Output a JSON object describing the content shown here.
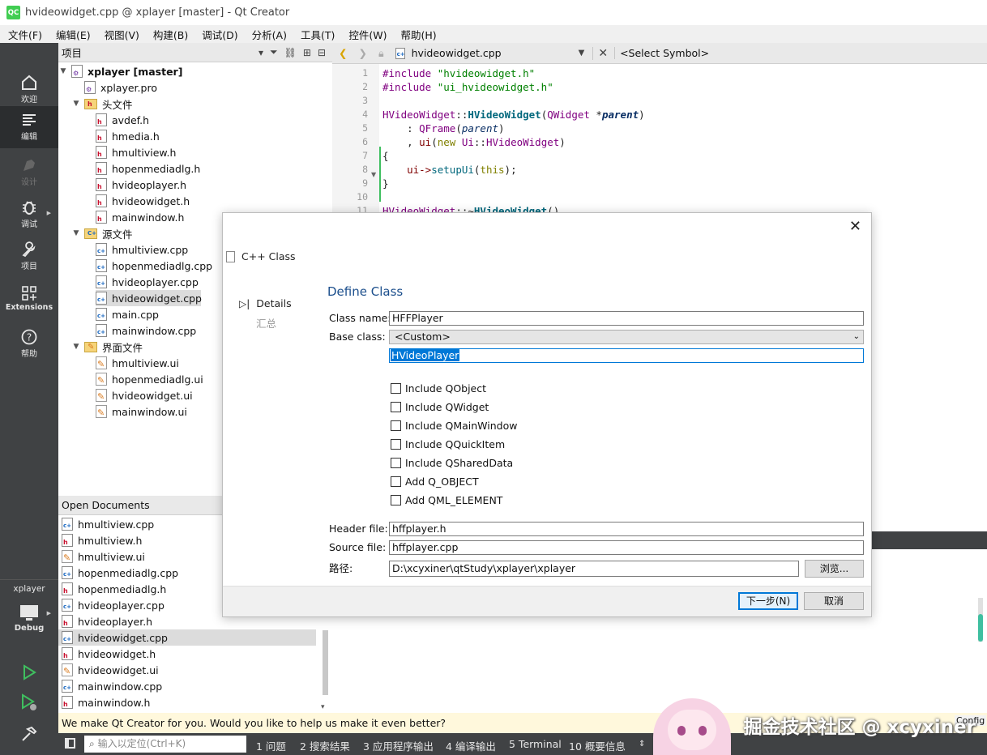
{
  "window": {
    "title": "hvideowidget.cpp @ xplayer [master] - Qt Creator",
    "app_icon": "QC"
  },
  "menu": [
    "文件(F)",
    "编辑(E)",
    "视图(V)",
    "构建(B)",
    "调试(D)",
    "分析(A)",
    "工具(T)",
    "控件(W)",
    "帮助(H)"
  ],
  "modes": [
    {
      "label": "欢迎",
      "icon": "welcome-icon"
    },
    {
      "label": "编辑",
      "icon": "edit-icon"
    },
    {
      "label": "设计",
      "icon": "design-icon"
    },
    {
      "label": "调试",
      "icon": "debug-bug-icon"
    },
    {
      "label": "项目",
      "icon": "projects-wrench-icon"
    },
    {
      "label": "Extensions",
      "icon": "extensions-icon"
    },
    {
      "label": "帮助",
      "icon": "help-icon"
    }
  ],
  "kit": {
    "project": "xplayer",
    "build": "Debug"
  },
  "project_pane": {
    "title": "项目"
  },
  "tree": {
    "root": "xplayer [master]",
    "pro": "xplayer.pro",
    "headers_folder": "头文件",
    "headers": [
      "avdef.h",
      "hmedia.h",
      "hmultiview.h",
      "hopenmediadlg.h",
      "hvideoplayer.h",
      "hvideowidget.h",
      "mainwindow.h"
    ],
    "sources_folder": "源文件",
    "sources": [
      "hmultiview.cpp",
      "hopenmediadlg.cpp",
      "hvideoplayer.cpp",
      "hvideowidget.cpp",
      "main.cpp",
      "mainwindow.cpp"
    ],
    "forms_folder": "界面文件",
    "forms": [
      "hmultiview.ui",
      "hopenmediadlg.ui",
      "hvideowidget.ui",
      "mainwindow.ui"
    ]
  },
  "open_docs": {
    "title": "Open Documents",
    "items": [
      "hmultiview.cpp",
      "hmultiview.h",
      "hmultiview.ui",
      "hopenmediadlg.cpp",
      "hopenmediadlg.h",
      "hvideoplayer.cpp",
      "hvideoplayer.h",
      "hvideowidget.cpp",
      "hvideowidget.h",
      "hvideowidget.ui",
      "mainwindow.cpp",
      "mainwindow.h"
    ]
  },
  "editor": {
    "file": "hvideowidget.cpp",
    "symbol": "<Select Symbol>",
    "line_numbers": [
      "1",
      "2",
      "3",
      "4",
      "5",
      "6",
      "7",
      "8",
      "9",
      "10",
      "11"
    ]
  },
  "code": {
    "l1a": "#include ",
    "l1b": "\"hvideowidget.h\"",
    "l2a": "#include ",
    "l2b": "\"ui_hvideowidget.h\"",
    "l4a": "HVideoWidget",
    "l4b": "::",
    "l4c": "HVideoWidget",
    "l4d": "(",
    "l4e": "QWidget",
    "l4f": " *",
    "l4g": "parent",
    "l4h": ")",
    "l5a": "    : ",
    "l5b": "QFrame",
    "l5c": "(",
    "l5d": "parent",
    "l5e": ")",
    "l6a": "    , ",
    "l6b": "ui",
    "l6c": "(",
    "l6d": "new",
    "l6e": " Ui",
    "l6f": "::",
    "l6g": "HVideoWidget",
    "l6h": ")",
    "l7": "{",
    "l8a": "    ui->",
    "l8b": "setupUi",
    "l8c": "(",
    "l8d": "this",
    "l8e": ");",
    "l9": "}",
    "l11a": "HVideoWidget",
    "l11b": "::~",
    "l11c": "HVideoWidget",
    "l11d": "()"
  },
  "dialog": {
    "title": "C++ Class",
    "steps": [
      "Details",
      "汇总"
    ],
    "heading": "Define Class",
    "class_name_label": "Class name:",
    "class_name": "HFFPlayer",
    "base_class_label": "Base class:",
    "base_class": "<Custom>",
    "custom_base": "HVideoPlayer",
    "options": [
      "Include QObject",
      "Include QWidget",
      "Include QMainWindow",
      "Include QQuickItem",
      "Include QSharedData",
      "Add Q_OBJECT",
      "Add QML_ELEMENT"
    ],
    "header_label": "Header file:",
    "header_file": "hffplayer.h",
    "source_label": "Source file:",
    "source_file": "hffplayer.cpp",
    "path_label": "路径:",
    "path": "D:\\xcyxiner\\qtStudy\\xplayer\\xplayer",
    "browse": "浏览...",
    "next": "下一步(N)",
    "cancel": "取消"
  },
  "feedback": "We make Qt Creator for you. Would you like to help us make it even better?",
  "bottom": {
    "locator_placeholder": "输入以定位(Ctrl+K)",
    "tabs": [
      "1  问题",
      "2  搜索结果",
      "3  应用程序输出",
      "4  编译输出",
      "5  Terminal",
      "10  概要信息"
    ],
    "config": "Config"
  },
  "watermark": "掘金技术社区 @ xcyxiner",
  "colors": {
    "modebar": "#404244",
    "accent": "#0066cc",
    "heading": "#1b4e8c",
    "qt_green": "#41cd52"
  }
}
